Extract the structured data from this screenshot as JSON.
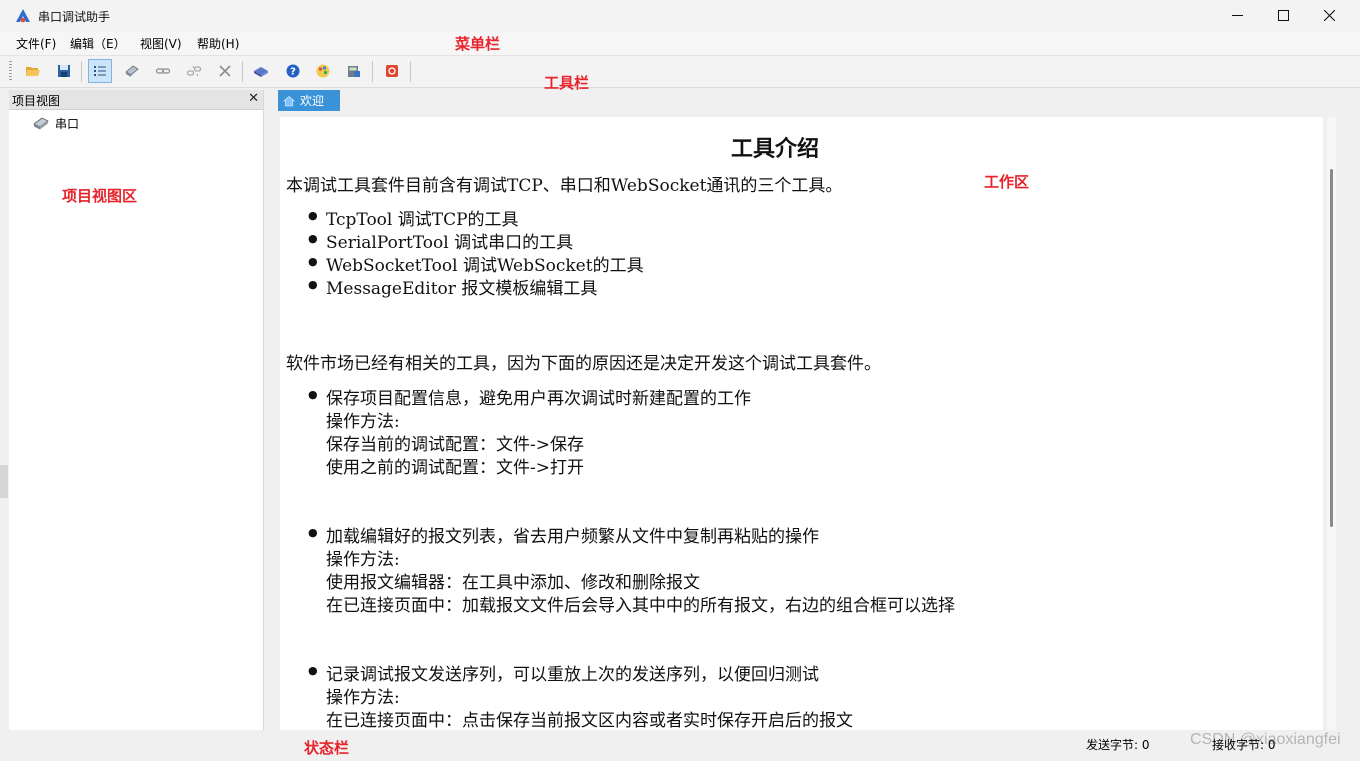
{
  "window": {
    "title": "串口调试助手"
  },
  "menu": [
    {
      "label": "文件(F)"
    },
    {
      "label": "编辑（E）"
    },
    {
      "label": "视图(V)"
    },
    {
      "label": "帮助(H)"
    }
  ],
  "toolbar": {
    "buttons": [
      {
        "icon": "open-folder-icon"
      },
      {
        "icon": "save-icon"
      },
      {
        "icon": "list-icon",
        "active": true
      },
      {
        "icon": "serial-icon"
      },
      {
        "icon": "link-icon"
      },
      {
        "icon": "unlink-icon"
      },
      {
        "icon": "close-x-icon"
      },
      {
        "icon": "book-icon"
      },
      {
        "icon": "help-icon"
      },
      {
        "icon": "palette-icon"
      },
      {
        "icon": "calculator-icon"
      },
      {
        "icon": "stop-icon"
      }
    ]
  },
  "project_panel": {
    "title": "项目视图",
    "close": "✕",
    "items": [
      {
        "label": "串口"
      }
    ]
  },
  "tab": {
    "label": "欢迎"
  },
  "doc": {
    "title": "工具介绍",
    "intro": "本调试工具套件目前含有调试TCP、串口和WebSocket通讯的三个工具。",
    "tools": [
      "TcpTool 调试TCP的工具",
      "SerialPortTool 调试串口的工具",
      "WebSocketTool 调试WebSocket的工具",
      "MessageEditor 报文模板编辑工具"
    ],
    "reason": "软件市场已经有相关的工具，因为下面的原因还是决定开发这个调试工具套件。",
    "reasons": [
      {
        "head": "保存项目配置信息，避免用户再次调试时新建配置的工作",
        "lines": [
          "操作方法:",
          "保存当前的调试配置：文件->保存",
          "使用之前的调试配置：文件->打开"
        ]
      },
      {
        "head": "加载编辑好的报文列表，省去用户频繁从文件中复制再粘贴的操作",
        "lines": [
          "操作方法:",
          "使用报文编辑器：在工具中添加、修改和删除报文",
          "在已连接页面中：加载报文文件后会导入其中中的所有报文，右边的组合框可以选择"
        ]
      },
      {
        "head": "记录调试报文发送序列，可以重放上次的发送序列，以便回归测试",
        "lines": [
          "操作方法:",
          "在已连接页面中：点击保存当前报文区内容或者实时保存开启后的报文"
        ]
      }
    ]
  },
  "status": {
    "send": "发送字节: 0",
    "recv": "接收字节: 0",
    "watermark": "CSDN @xiaoxiangfei"
  },
  "annotations": {
    "menubar": "菜单栏",
    "toolbar": "工具栏",
    "project_view": "项目视图区",
    "work_area": "工作区",
    "status_bar": "状态栏"
  }
}
